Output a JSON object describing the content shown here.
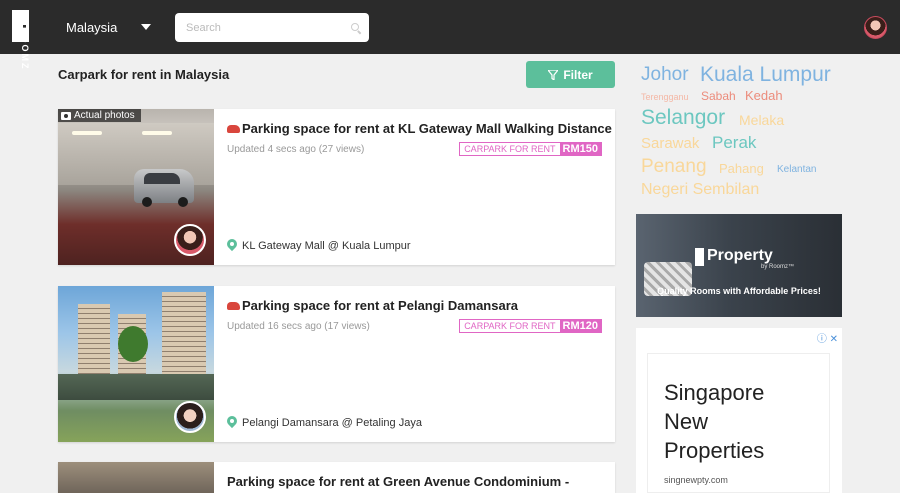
{
  "header": {
    "brand": "ROOMZ",
    "country": "Malaysia",
    "search_placeholder": "Search"
  },
  "page": {
    "title": "Carpark for rent in Malaysia",
    "filter_label": "Filter"
  },
  "listings": [
    {
      "title": "Parking space for rent at KL Gateway Mall Walking Distance",
      "meta": "Updated 4 secs ago (27 views)",
      "type": "CARPARK FOR RENT",
      "price": "RM150",
      "location": "KL Gateway Mall @ Kuala Lumpur",
      "badge": "Actual photos"
    },
    {
      "title": "Parking space for rent at Pelangi Damansara",
      "meta": "Updated 16 secs ago (17 views)",
      "type": "CARPARK FOR RENT",
      "price": "RM120",
      "location": "Pelangi Damansara @ Petaling Jaya"
    },
    {
      "title": "Parking space for rent at Green Avenue Condominium -"
    }
  ],
  "states": [
    {
      "label": "Johor",
      "color": "#7fb3e0"
    },
    {
      "label": "Kuala Lumpur",
      "color": "#7fb3e0"
    },
    {
      "label": "Terengganu",
      "color": "#f4b8a6"
    },
    {
      "label": "Sabah",
      "color": "#ec8c7c"
    },
    {
      "label": "Kedah",
      "color": "#ec8c7c"
    },
    {
      "label": "Selangor",
      "color": "#6cc7c0"
    },
    {
      "label": "Melaka",
      "color": "#f9d79a"
    },
    {
      "label": "Sarawak",
      "color": "#f9d79a"
    },
    {
      "label": "Perak",
      "color": "#6cc7c0"
    },
    {
      "label": "Penang",
      "color": "#f9d79a"
    },
    {
      "label": "Pahang",
      "color": "#f9d79a"
    },
    {
      "label": "Kelantan",
      "color": "#7fb3e0"
    },
    {
      "label": "Negeri Sembilan",
      "color": "#f9d79a"
    }
  ],
  "ads": {
    "property_brand": "Property",
    "property_byline": "by Roomz™",
    "property_tagline": "Quality Rooms with Affordable Prices!",
    "adchoices": "ⓘ ✕",
    "headline_1": "Singapore",
    "headline_2": "New",
    "headline_3": "Properties",
    "domain": "singnewpty.com"
  }
}
